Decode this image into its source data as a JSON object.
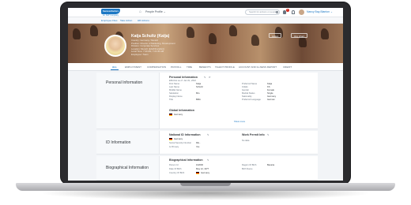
{
  "shell": {
    "logo": "SuccessFactors",
    "logo_sub": "An SAP Company",
    "home_icon": "home-icon",
    "profile_menu": "People Profile ⌄",
    "search_placeholder": "Search for actions or people",
    "notif_count": "1",
    "user_name": "Nancy Bay-Blanton ⌄"
  },
  "subnav": [
    "Employee Files",
    "Take Action",
    "HR Actions"
  ],
  "header": {
    "name": "Katja Schultz (Katja)",
    "lines": [
      "Country: Germany / Munich",
      "Position: Director of Marketing, Development",
      "Division: Corporate Services",
      "Location: Munich (EAM/Frankfurt)",
      "Local Time: 7:40 AM, 7:21:35 AM",
      "Employee / Team"
    ],
    "actions": [
      "Action",
      "Org Chart"
    ]
  },
  "tabs": {
    "items": [
      "ALL",
      "EMPLOYMENT",
      "COMPENSATION",
      "PAYROLL",
      "TIME",
      "BENEFITS",
      "TALENT PROFILE",
      "ACCOUNT AND ILLNESS REPORT",
      "CREDIT"
    ],
    "active": "ALL"
  },
  "personal": {
    "section_title": "Personal Information",
    "card_title": "Personal Information",
    "effective": "Effective as of: Jan 01, 2016",
    "left_rows": [
      {
        "label": "First Name",
        "value": "Katja"
      },
      {
        "label": "Last Name",
        "value": "Schultz"
      },
      {
        "label": "Middle Name",
        "value": ""
      },
      {
        "label": "Salutation",
        "value": "Mrs."
      },
      {
        "label": "Display Name",
        "value": ""
      },
      {
        "label": "Title",
        "value": "BMA"
      }
    ],
    "right_rows": [
      {
        "label": "Preferred Name",
        "value": "Katja"
      },
      {
        "label": "Initials",
        "value": "KS"
      },
      {
        "label": "Gender",
        "value": "Female"
      },
      {
        "label": "Marital Status",
        "value": "Single"
      },
      {
        "label": "Nationality",
        "value": "Germany"
      },
      {
        "label": "Preferred Language",
        "value": "German"
      }
    ],
    "global_title": "Global Information",
    "global_value": "Germany",
    "show_more": "Show more"
  },
  "id_info": {
    "section_title": "ID Information",
    "national_title": "National ID Information",
    "national_country": "Germany",
    "national_rows": [
      {
        "label": "Social Security Number",
        "value": "DE..."
      },
      {
        "label": "Is Primary",
        "value": "Yes"
      }
    ],
    "work_permit_title": "Work Permit Info",
    "work_permit_value": "No data"
  },
  "bio": {
    "section_title": "Biographical Information",
    "card_title": "Biographical Information",
    "left_rows": [
      {
        "label": "Person Id",
        "value": "102000"
      },
      {
        "label": "Date Of Birth",
        "value": "May 12, 1977"
      },
      {
        "label": "Country Of Birth",
        "value": "Germany"
      }
    ],
    "right_rows": [
      {
        "label": "Region Of Birth",
        "value": "Bavaria"
      },
      {
        "label": "Birth Name",
        "value": ""
      }
    ]
  },
  "colors": {
    "brand": "#1d78c4",
    "laptop": "#2b2b2e"
  }
}
